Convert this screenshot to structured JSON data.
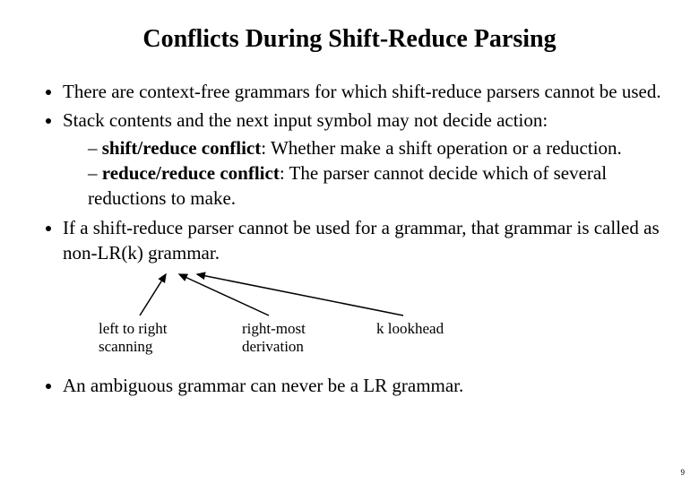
{
  "title": "Conflicts During Shift-Reduce Parsing",
  "bullets": {
    "b1": "There are context-free grammars for which shift-reduce parsers cannot be used.",
    "b2": "Stack contents and the next input symbol may not decide action:",
    "b2a_bold": "shift/reduce conflict",
    "b2a_rest": ": Whether make a shift operation or a reduction.",
    "b2b_bold": "reduce/reduce conflict",
    "b2b_rest": ": The parser cannot decide which of several reductions to make.",
    "b3": "If a shift-reduce parser cannot be used for a grammar, that grammar is called as non-LR(k) grammar.",
    "b4": "An ambiguous grammar can never be a LR grammar."
  },
  "labels": {
    "l1a": "left to right",
    "l1b": "scanning",
    "l2a": "right-most",
    "l2b": "derivation",
    "l3": "k lookhead"
  },
  "page_number": "9"
}
